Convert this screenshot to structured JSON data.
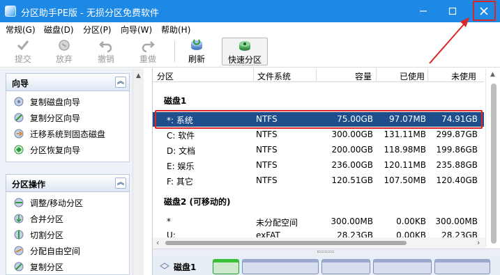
{
  "window": {
    "title": "分区助手PE版 - 无损分区免费软件",
    "min_glyph": "─",
    "max_glyph": "☐",
    "close_glyph": "✕",
    "accent_color": "#1e88e5",
    "highlight_color": "#d92626"
  },
  "menu": [
    {
      "label": "常规(G)"
    },
    {
      "label": "磁盘(D)"
    },
    {
      "label": "分区(P)"
    },
    {
      "label": "向导(W)"
    },
    {
      "label": "帮助(H)"
    }
  ],
  "toolbar": [
    {
      "label": "提交",
      "icon": "check-icon",
      "enabled": false
    },
    {
      "label": "放弃",
      "icon": "discard-icon",
      "enabled": false
    },
    {
      "label": "撤销",
      "icon": "undo-icon",
      "enabled": false
    },
    {
      "label": "重做",
      "icon": "redo-icon",
      "enabled": false
    },
    {
      "label": "刷新",
      "icon": "refresh-icon",
      "enabled": true
    },
    {
      "label": "快速分区",
      "icon": "quick-partition-icon",
      "enabled": true
    }
  ],
  "sidebar": {
    "wizard_panel": {
      "title": "向导",
      "collapse_glyph": "︽",
      "items": [
        {
          "label": "复制磁盘向导",
          "icon": "copy-disk-icon"
        },
        {
          "label": "复制分区向导",
          "icon": "copy-partition-icon"
        },
        {
          "label": "迁移系统到固态磁盘",
          "icon": "migrate-os-icon"
        },
        {
          "label": "分区恢复向导",
          "icon": "partition-recovery-icon"
        }
      ]
    },
    "partition_panel": {
      "title": "分区操作",
      "collapse_glyph": "︽",
      "items": [
        {
          "label": "调整/移动分区",
          "icon": "resize-move-icon"
        },
        {
          "label": "合并分区",
          "icon": "merge-icon"
        },
        {
          "label": "切割分区",
          "icon": "split-icon"
        },
        {
          "label": "分配自由空间",
          "icon": "allocate-space-icon"
        },
        {
          "label": "复制分区",
          "icon": "copy-partition-icon"
        }
      ]
    }
  },
  "table": {
    "columns": [
      "分区",
      "文件系统",
      "容量",
      "已使用",
      "未使用"
    ],
    "groups": [
      {
        "name": "磁盘1",
        "rows": [
          {
            "partition": "*: 系统",
            "fs": "NTFS",
            "capacity": "75.00GB",
            "used": "97.07MB",
            "free": "74.91GB",
            "selected": true
          },
          {
            "partition": "C: 软件",
            "fs": "NTFS",
            "capacity": "300.00GB",
            "used": "131.11MB",
            "free": "299.87GB",
            "selected": false
          },
          {
            "partition": "D: 文档",
            "fs": "NTFS",
            "capacity": "200.00GB",
            "used": "118.98MB",
            "free": "199.86GB",
            "selected": false
          },
          {
            "partition": "E: 娱乐",
            "fs": "NTFS",
            "capacity": "236.00GB",
            "used": "120.11MB",
            "free": "235.88GB",
            "selected": false
          },
          {
            "partition": "F: 其它",
            "fs": "NTFS",
            "capacity": "120.51GB",
            "used": "107.50MB",
            "free": "120.40GB",
            "selected": false
          }
        ]
      },
      {
        "name": "磁盘2 (可移动的)",
        "rows": [
          {
            "partition": "*",
            "fs": "未分配空间",
            "capacity": "300.00MB",
            "used": "0.00KB",
            "free": "300.00MB",
            "selected": false
          },
          {
            "partition": "U:",
            "fs": "exFAT",
            "capacity": "28.23GB",
            "used": "0.00KB",
            "free": "28.23GB",
            "selected": false
          }
        ]
      }
    ]
  },
  "diskmap": {
    "disk_label": "磁盘1"
  }
}
